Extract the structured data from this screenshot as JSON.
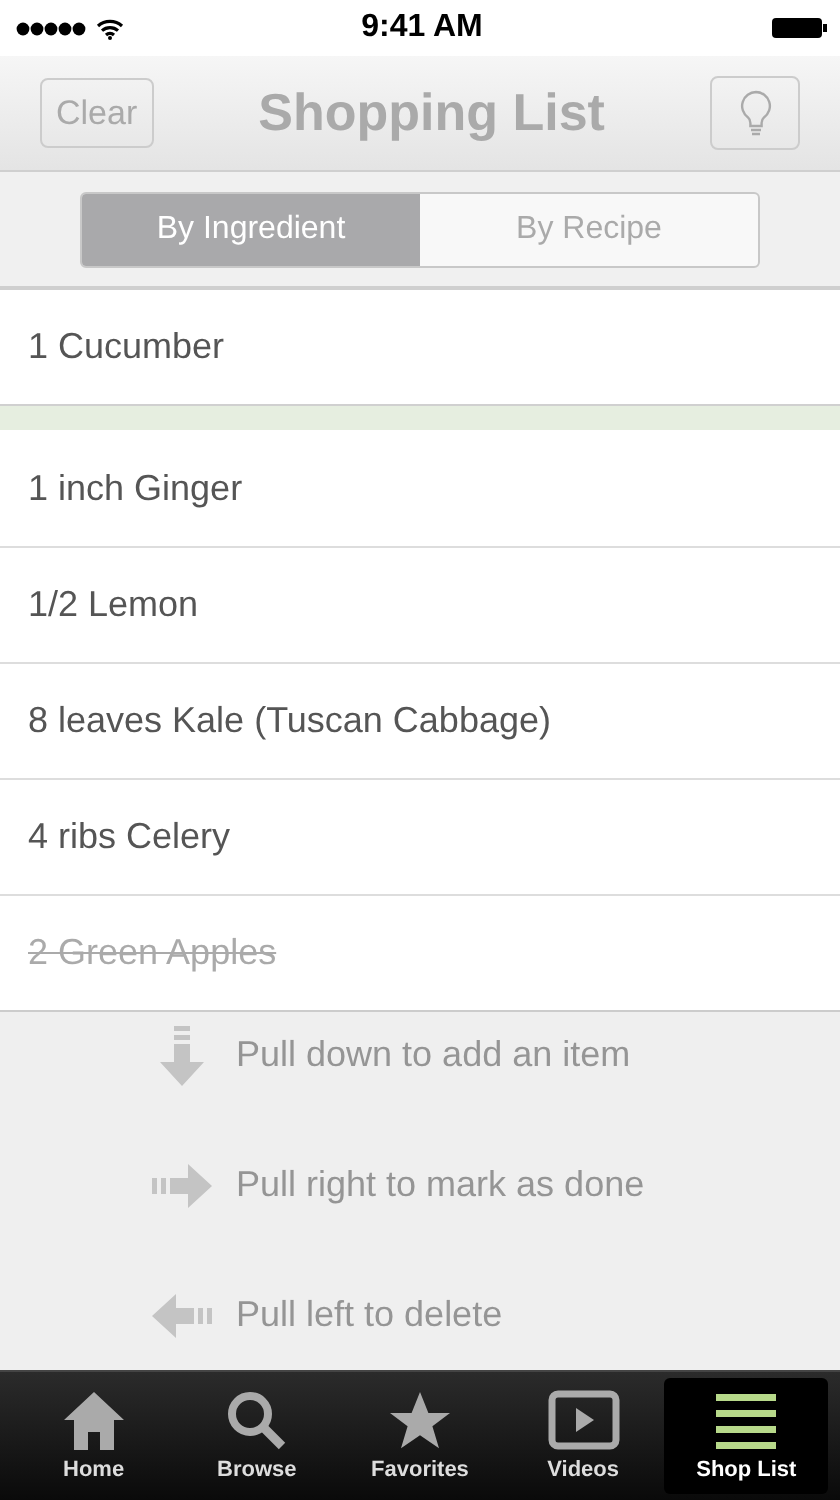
{
  "status_bar": {
    "time": "9:41 AM"
  },
  "nav": {
    "left_button": "Clear",
    "title": "Shopping List"
  },
  "segments": [
    {
      "label": "By Ingredient",
      "selected": true
    },
    {
      "label": "By Recipe",
      "selected": false
    }
  ],
  "items": [
    {
      "text": "1 Cucumber",
      "done": false
    },
    {
      "text": "1 inch Ginger",
      "done": false
    },
    {
      "text": "1/2 Lemon",
      "done": false
    },
    {
      "text": "8 leaves Kale (Tuscan Cabbage)",
      "done": false
    },
    {
      "text": "4 ribs Celery",
      "done": false
    },
    {
      "text": "2 Green Apples",
      "done": true
    }
  ],
  "hints": [
    {
      "kind": "down",
      "text": "Pull down to add an item"
    },
    {
      "kind": "right",
      "text": "Pull right to mark as done"
    },
    {
      "kind": "left",
      "text": "Pull left to delete"
    }
  ],
  "tabs": [
    {
      "kind": "home",
      "label": "Home",
      "selected": false
    },
    {
      "kind": "search",
      "label": "Browse",
      "selected": false
    },
    {
      "kind": "star",
      "label": "Favorites",
      "selected": false
    },
    {
      "kind": "video",
      "label": "Videos",
      "selected": false
    },
    {
      "kind": "list",
      "label": "Shop List",
      "selected": true
    }
  ]
}
